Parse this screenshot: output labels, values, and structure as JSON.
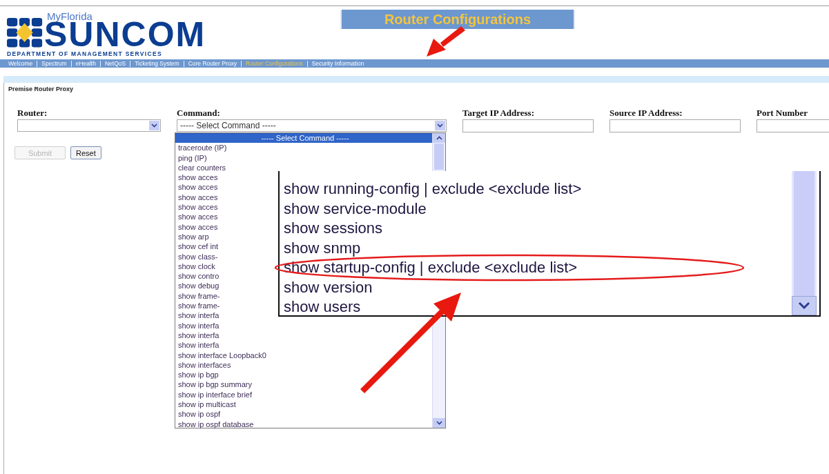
{
  "logo": {
    "top": "MyFlorida",
    "name": "SUNCOM",
    "department": "DEPARTMENT OF MANAGEMENT SERVICES"
  },
  "page_title": "Router Configurations",
  "nav": [
    {
      "label": "Welcome",
      "selected": false
    },
    {
      "label": "Spectrum",
      "selected": false
    },
    {
      "label": "eHealth",
      "selected": false
    },
    {
      "label": "NetQoS",
      "selected": false
    },
    {
      "label": "Ticketing System",
      "selected": false
    },
    {
      "label": "Core Router Proxy",
      "selected": false
    },
    {
      "label": "Router Configurations",
      "selected": true
    },
    {
      "label": "Security Information",
      "selected": false
    }
  ],
  "section_title": "Premise Router Proxy",
  "form": {
    "router_label": "Router:",
    "command_label": "Command:",
    "command_value": "----- Select Command -----",
    "target_label": "Target IP Address:",
    "source_label": "Source IP Address:",
    "port_label": "Port Number"
  },
  "buttons": [
    {
      "label": "Submit",
      "disabled": true
    },
    {
      "label": "Reset",
      "disabled": false
    }
  ],
  "command_options": [
    {
      "label": "----- Select Command -----",
      "selected": true
    },
    {
      "label": "traceroute (IP)",
      "selected": false
    },
    {
      "label": "ping (IP)",
      "selected": false
    },
    {
      "label": "clear counters",
      "selected": false
    },
    {
      "label": "show acces",
      "selected": false
    },
    {
      "label": "show acces",
      "selected": false
    },
    {
      "label": "show acces",
      "selected": false
    },
    {
      "label": "show acces",
      "selected": false
    },
    {
      "label": "show acces",
      "selected": false
    },
    {
      "label": "show acces",
      "selected": false
    },
    {
      "label": "show arp",
      "selected": false
    },
    {
      "label": "show cef int",
      "selected": false
    },
    {
      "label": "show class-",
      "selected": false
    },
    {
      "label": "show clock",
      "selected": false
    },
    {
      "label": "show contro",
      "selected": false
    },
    {
      "label": "show debug",
      "selected": false
    },
    {
      "label": "show frame-",
      "selected": false
    },
    {
      "label": "show frame-",
      "selected": false
    },
    {
      "label": "show interfa",
      "selected": false
    },
    {
      "label": "show interfa",
      "selected": false
    },
    {
      "label": "show interfa",
      "selected": false
    },
    {
      "label": "show interfa",
      "selected": false
    },
    {
      "label": "show interface Loopback0",
      "selected": false
    },
    {
      "label": "show interfaces",
      "selected": false
    },
    {
      "label": "show ip bgp",
      "selected": false
    },
    {
      "label": "show ip bgp summary",
      "selected": false
    },
    {
      "label": "show ip interface brief",
      "selected": false
    },
    {
      "label": "show ip multicast",
      "selected": false
    },
    {
      "label": "show ip ospf",
      "selected": false
    },
    {
      "label": "show ip ospf database",
      "selected": false
    }
  ],
  "inset_options": [
    {
      "label": "show running-config | exclude <exclude list>",
      "circled": false
    },
    {
      "label": "show service-module",
      "circled": false
    },
    {
      "label": "show sessions",
      "circled": false
    },
    {
      "label": "show snmp",
      "circled": false
    },
    {
      "label": "show startup-config | exclude <exclude list>",
      "circled": true
    },
    {
      "label": "show version",
      "circled": false
    },
    {
      "label": "show users",
      "circled": false
    }
  ]
}
